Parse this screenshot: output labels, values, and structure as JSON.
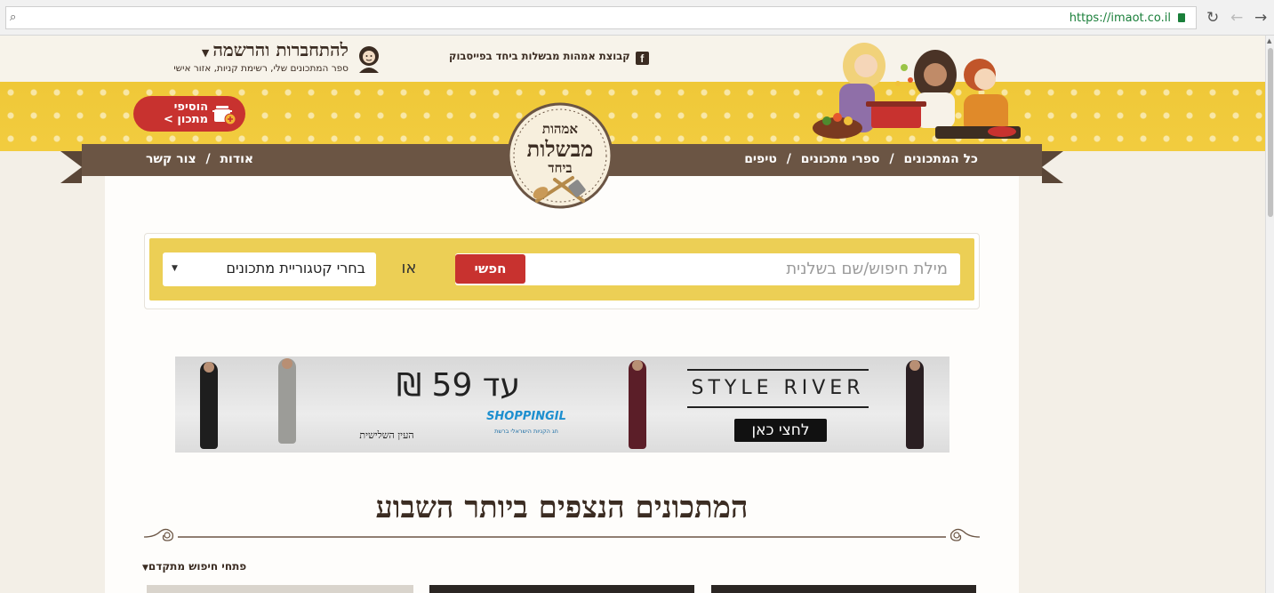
{
  "browser": {
    "url": "https://imaot.co.il",
    "reload_icon": "reload-icon",
    "back_icon": "back-arrow-icon",
    "forward_icon": "forward-arrow-icon"
  },
  "header": {
    "signup_title": "להתחברות והרשמה",
    "signup_subtitle": "ספר המתכונים שלי, רשימת קניות, אזור אישי",
    "facebook_group": "קבוצת אמהות מבשלות ביחד בפייסבוק",
    "add_recipe_line1": "הוסיפי",
    "add_recipe_line2": "מתכון >",
    "logo_line1": "אמהות",
    "logo_line2": "מבשלות",
    "logo_line3": "ביחד"
  },
  "nav": {
    "right": [
      "כל המתכונים",
      "ספרי מתכונים",
      "טיפים"
    ],
    "left": [
      "אודות",
      "צור קשר"
    ],
    "separator": "/"
  },
  "search": {
    "placeholder": "מילת חיפוש/שם בשלנית",
    "button": "חפשי",
    "or_label": "או",
    "category_select": "בחרי קטגוריית מתכונים"
  },
  "ad": {
    "price": "עד 59 ₪",
    "brand": "STYLE RIVER",
    "cta": "לחצי כאן",
    "shop_name": "SHOPPINGIL",
    "shop_tagline": "חג הקניות הישראלי ברשת",
    "third_eye": "העין השלישית"
  },
  "main": {
    "heading": "המתכונים הנצפים ביותר השבוע",
    "advanced_search": "פתחי חיפוש מתקדם"
  },
  "colors": {
    "brand_red": "#c8322f",
    "ribbon_brown": "#6b5544",
    "band_yellow": "#efc838",
    "search_yellow": "#eccf55",
    "text_dark": "#3b2c22"
  }
}
